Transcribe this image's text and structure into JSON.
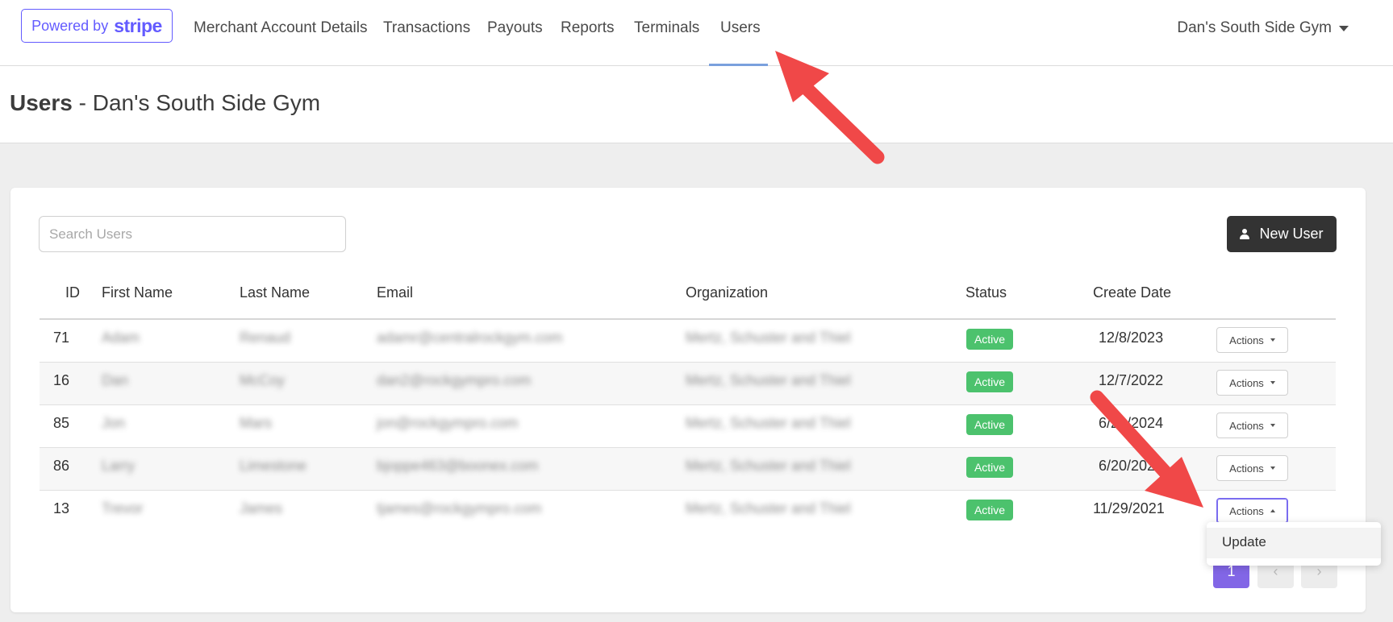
{
  "nav": {
    "powered_by": "Powered by",
    "brand": "stripe",
    "links": [
      "Merchant Account Details",
      "Transactions",
      "Payouts",
      "Reports",
      "Terminals",
      "Users"
    ],
    "active": "Users",
    "account": "Dan's South Side Gym"
  },
  "page": {
    "title_bold": "Users",
    "title_rest": " - Dan's South Side Gym"
  },
  "search": {
    "placeholder": "Search Users",
    "value": ""
  },
  "new_user_label": "New User",
  "table": {
    "headers": [
      "ID",
      "First Name",
      "Last Name",
      "Email",
      "Organization",
      "Status",
      "Create Date"
    ],
    "rows": [
      {
        "id": "71",
        "first": "Adam",
        "last": "Renaud",
        "email": "adamr@centralrockgym.com",
        "org": "Mertz, Schuster and Thiel",
        "status": "Active",
        "created": "12/8/2023"
      },
      {
        "id": "16",
        "first": "Dan",
        "last": "McCoy",
        "email": "dan2@rockgympro.com",
        "org": "Mertz, Schuster and Thiel",
        "status": "Active",
        "created": "12/7/2022"
      },
      {
        "id": "85",
        "first": "Jon",
        "last": "Mars",
        "email": "jon@rockgympro.com",
        "org": "Mertz, Schuster and Thiel",
        "status": "Active",
        "created": "6/20/2024"
      },
      {
        "id": "86",
        "first": "Larry",
        "last": "Limestone",
        "email": "bjoppe463@boonex.com",
        "org": "Mertz, Schuster and Thiel",
        "status": "Active",
        "created": "6/20/2024"
      },
      {
        "id": "13",
        "first": "Trevor",
        "last": "James",
        "email": "tjames@rockgympro.com",
        "org": "Mertz, Schuster and Thiel",
        "status": "Active",
        "created": "11/29/2021"
      }
    ],
    "actions_label": "Actions"
  },
  "dropdown": {
    "items": [
      "Update"
    ]
  },
  "pagination": {
    "current": "1",
    "prev": "‹",
    "next": "›"
  },
  "colors": {
    "stripe": "#635bff",
    "active_badge": "#4cc26d",
    "pagination": "#8266e6",
    "annotation_arrow": "#f04848"
  },
  "icons": {
    "user": "user-icon",
    "account_caret": "chevron-down-icon",
    "actions_caret": "caret-icon"
  }
}
